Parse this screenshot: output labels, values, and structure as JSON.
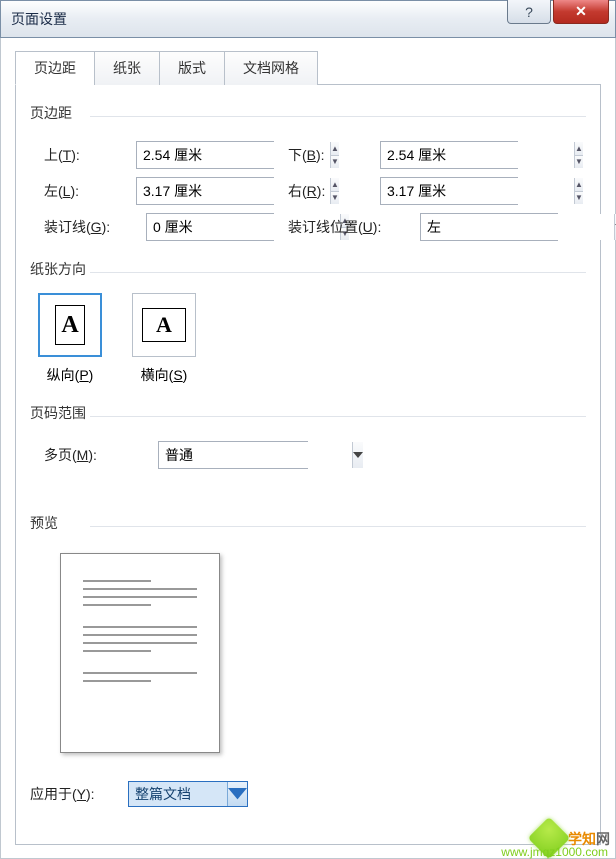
{
  "window": {
    "title": "页面设置"
  },
  "tabs": [
    {
      "label": "页边距",
      "active": true
    },
    {
      "label": "纸张",
      "active": false
    },
    {
      "label": "版式",
      "active": false
    },
    {
      "label": "文档网格",
      "active": false
    }
  ],
  "margins": {
    "group_label": "页边距",
    "top_label": "上(T):",
    "top_value": "2.54 厘米",
    "bottom_label": "下(B):",
    "bottom_value": "2.54 厘米",
    "left_label": "左(L):",
    "left_value": "3.17 厘米",
    "right_label": "右(R):",
    "right_value": "3.17 厘米",
    "gutter_label": "装订线(G):",
    "gutter_value": "0 厘米",
    "gutter_pos_label": "装订线位置(U):",
    "gutter_pos_value": "左"
  },
  "orientation": {
    "group_label": "纸张方向",
    "portrait_label": "纵向(P)",
    "landscape_label": "横向(S)",
    "selected": "portrait"
  },
  "pages": {
    "group_label": "页码范围",
    "multi_label": "多页(M):",
    "multi_value": "普通"
  },
  "preview": {
    "group_label": "预览"
  },
  "apply": {
    "label": "应用于(Y):",
    "value": "整篇文档"
  },
  "watermark": {
    "text_a": "学知",
    "text_b": "网",
    "url": "www.jmqz1000.com"
  }
}
